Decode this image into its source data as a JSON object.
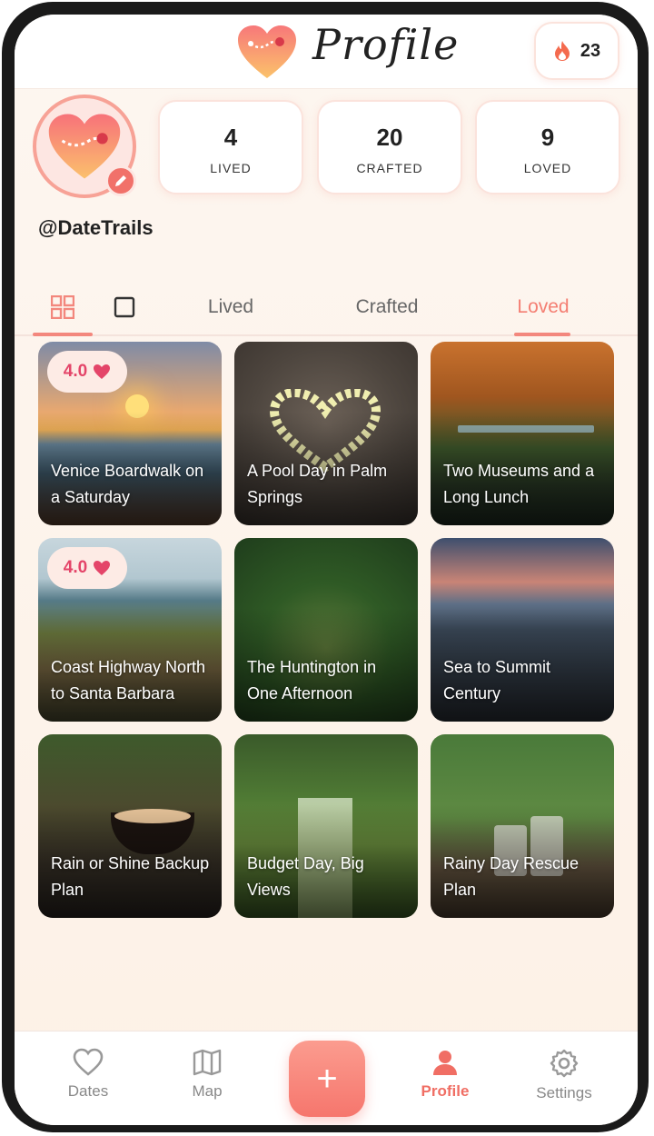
{
  "header": {
    "title": "Profile",
    "streak_count": "23"
  },
  "profile": {
    "username": "@DateTrails",
    "stats": [
      {
        "value": "4",
        "label": "LIVED"
      },
      {
        "value": "20",
        "label": "CRAFTED"
      },
      {
        "value": "9",
        "label": "LOVED"
      }
    ]
  },
  "tabs": {
    "lived": "Lived",
    "crafted": "Crafted",
    "loved": "Loved",
    "active": "Loved"
  },
  "cards": [
    {
      "title": "Venice Boardwalk on a Saturday",
      "rating": "4.0"
    },
    {
      "title": "A Pool Day in Palm Springs"
    },
    {
      "title": "Two Museums and a Long Lunch"
    },
    {
      "title": "Coast Highway North to Santa Barbara",
      "rating": "4.0"
    },
    {
      "title": "The Huntington in One Afternoon"
    },
    {
      "title": "Sea to Summit Century"
    },
    {
      "title": "Rain or Shine Backup Plan"
    },
    {
      "title": "Budget Day, Big Views"
    },
    {
      "title": "Rainy Day Rescue Plan"
    }
  ],
  "nav": {
    "dates": "Dates",
    "map": "Map",
    "add": "+",
    "profile": "Profile",
    "settings": "Settings",
    "active": "Profile"
  },
  "colors": {
    "accent": "#f3877d",
    "rating": "#e44569"
  }
}
